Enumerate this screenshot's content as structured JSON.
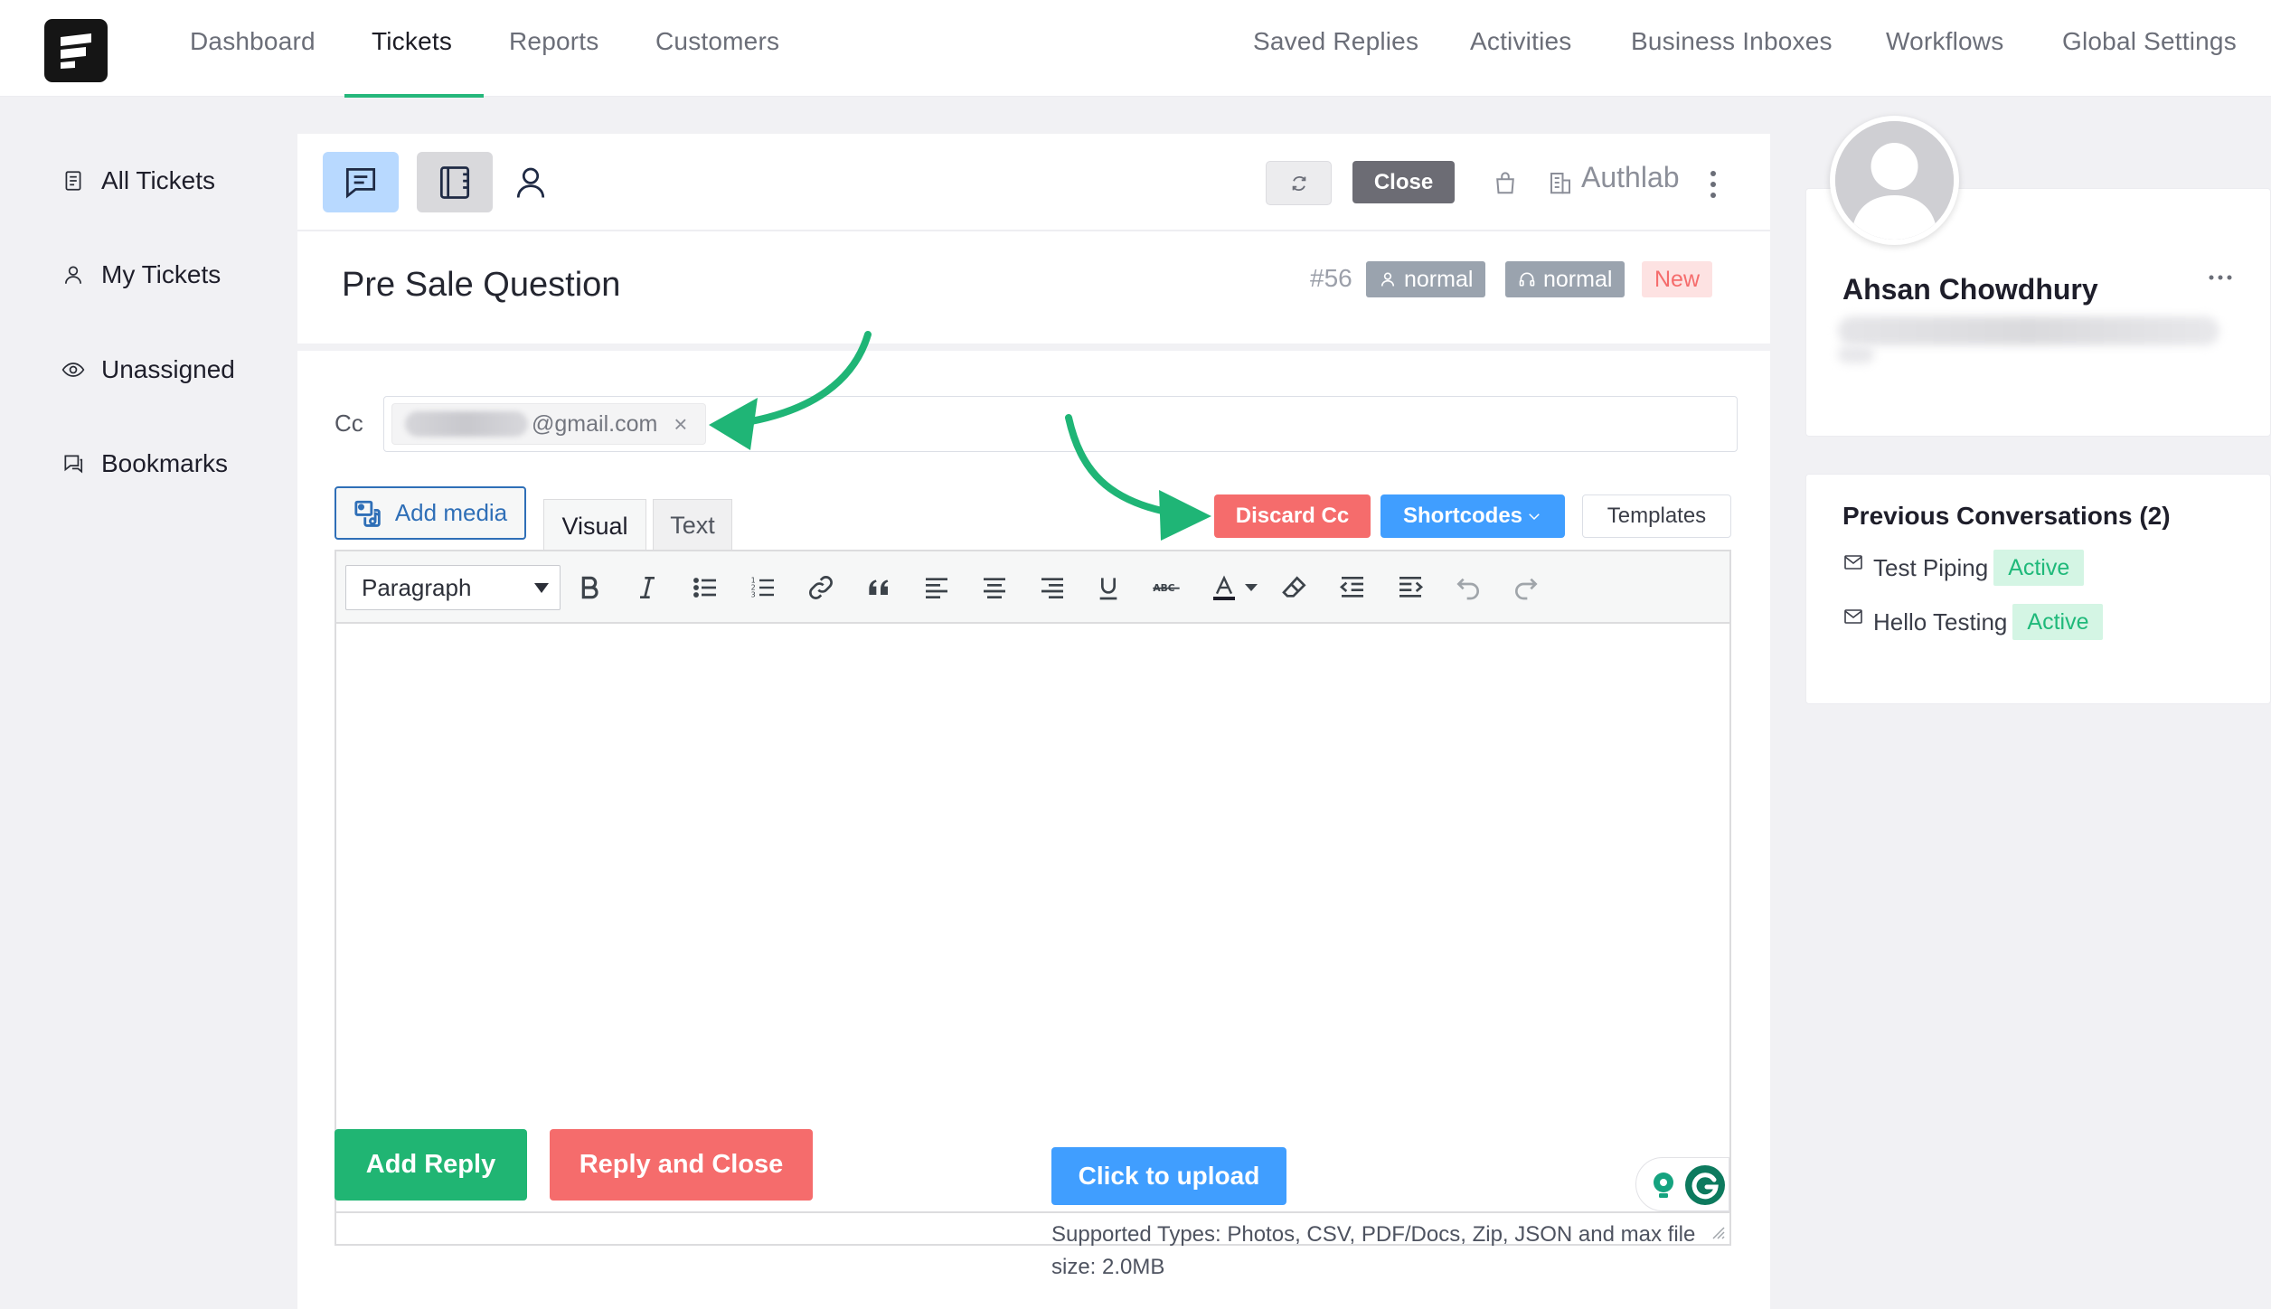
{
  "nav": {
    "items": [
      "Dashboard",
      "Tickets",
      "Reports",
      "Customers"
    ],
    "right_items": [
      "Saved Replies",
      "Activities",
      "Business Inboxes",
      "Workflows",
      "Global Settings"
    ],
    "active": "Tickets"
  },
  "sidebar": {
    "items": [
      {
        "label": "All Tickets",
        "icon": "document-icon"
      },
      {
        "label": "My Tickets",
        "icon": "user-icon"
      },
      {
        "label": "Unassigned",
        "icon": "eye-icon"
      },
      {
        "label": "Bookmarks",
        "icon": "bookmark-icon"
      }
    ]
  },
  "toolbar": {
    "close_label": "Close",
    "company": "Authlab"
  },
  "ticket": {
    "title": "Pre Sale Question",
    "number": "#56",
    "badge_priority_customer": "normal",
    "badge_priority_agent": "normal",
    "badge_status": "New"
  },
  "reply": {
    "cc_label": "Cc",
    "cc_email_suffix": "@gmail.com",
    "cc_remove": "×",
    "add_media": "Add media",
    "tab_visual": "Visual",
    "tab_text": "Text",
    "discard_cc": "Discard Cc",
    "shortcodes": "Shortcodes",
    "templates": "Templates",
    "paragraph": "Paragraph",
    "add_reply": "Add Reply",
    "reply_and_close": "Reply and Close",
    "upload": "Click to upload",
    "upload_hint": "Supported Types: Photos, CSV, PDF/Docs, Zip, JSON and max file size: 2.0MB"
  },
  "customer": {
    "name": "Ahsan Chowdhury"
  },
  "previous": {
    "title": "Previous Conversations (2)",
    "items": [
      {
        "subject": "Test Piping",
        "status": "Active"
      },
      {
        "subject": "Hello Testing",
        "status": "Active"
      }
    ]
  },
  "colors": {
    "accent_green": "#25b77b",
    "danger": "#f56c6c",
    "primary": "#409eff",
    "annotation_arrow": "#1fb576"
  }
}
